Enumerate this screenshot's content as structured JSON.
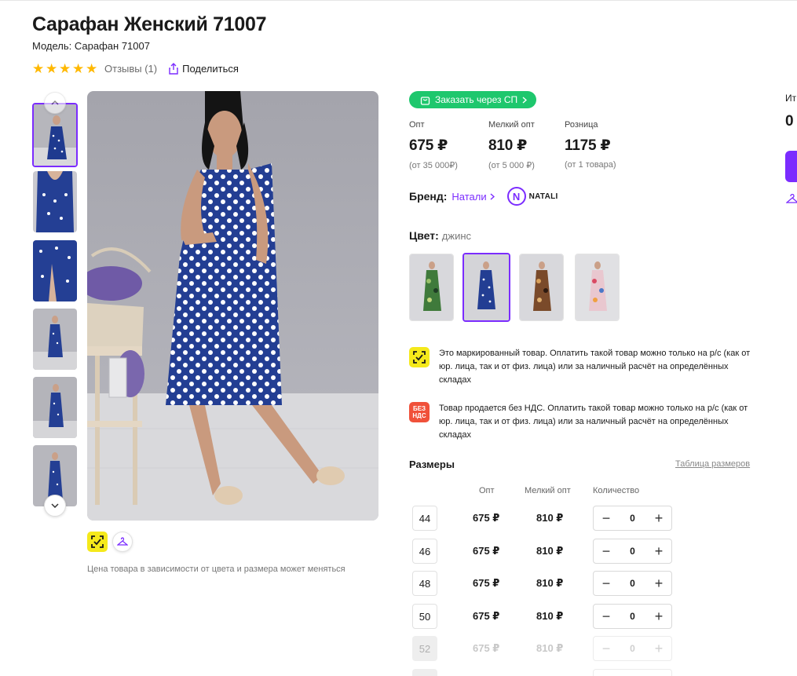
{
  "product": {
    "title": "Сарафан Женский 71007",
    "model": "Модель: Сарафан 71007",
    "rating_stars": 5,
    "reviews": "Отзывы (1)",
    "share": "Поделиться"
  },
  "gallery": {
    "thumbnail_count": 6,
    "active_index": 0,
    "price_note": "Цена товара в зависимости от цвета и размера может меняться"
  },
  "order": {
    "sp_button": "Заказать через СП"
  },
  "prices": [
    {
      "label": "Опт",
      "value": "675 ₽",
      "sub": "(от 35 000₽)"
    },
    {
      "label": "Мелкий опт",
      "value": "810 ₽",
      "sub": "(от 5 000 ₽)"
    },
    {
      "label": "Розница",
      "value": "1175 ₽",
      "sub": "(от 1 товара)"
    }
  ],
  "brand": {
    "label": "Бренд:",
    "name": "Натали",
    "logo_letter": "N",
    "logo_text": "NATALI"
  },
  "color": {
    "label": "Цвет:",
    "value": "джинс",
    "swatch_count": 4,
    "active_index": 1
  },
  "notices": [
    {
      "icon": "marking-icon",
      "text": "Это маркированный товар. Оплатить такой товар можно только на р/с (как от юр. лица, так и от физ. лица) или за наличный расчёт на определённых складах"
    },
    {
      "icon": "no-vat-icon",
      "icon_text_1": "БЕЗ",
      "icon_text_2": "НДС",
      "text": "Товар продается без НДС. Оплатить такой товар можно только на р/с (как от юр. лица, так и от физ. лица) или за наличный расчёт на определённых складах"
    }
  ],
  "sizes": {
    "title": "Размеры",
    "table_link": "Таблица размеров",
    "columns": [
      "Опт",
      "Мелкий опт",
      "Количество"
    ],
    "rows": [
      {
        "size": "44",
        "opt": "675 ₽",
        "small_opt": "810 ₽",
        "qty": "0",
        "available": true
      },
      {
        "size": "46",
        "opt": "675 ₽",
        "small_opt": "810 ₽",
        "qty": "0",
        "available": true
      },
      {
        "size": "48",
        "opt": "675 ₽",
        "small_opt": "810 ₽",
        "qty": "0",
        "available": true
      },
      {
        "size": "50",
        "opt": "675 ₽",
        "small_opt": "810 ₽",
        "qty": "0",
        "available": true
      },
      {
        "size": "52",
        "opt": "675 ₽",
        "small_opt": "810 ₽",
        "qty": "0",
        "available": false
      }
    ]
  },
  "sidebar": {
    "label": "Ит",
    "value": "0"
  },
  "colors": {
    "accent": "#7b2cff",
    "green": "#1ec76d",
    "star": "#ffb800",
    "marking_yellow": "#f5e91b",
    "no_vat_red": "#f0513a"
  }
}
